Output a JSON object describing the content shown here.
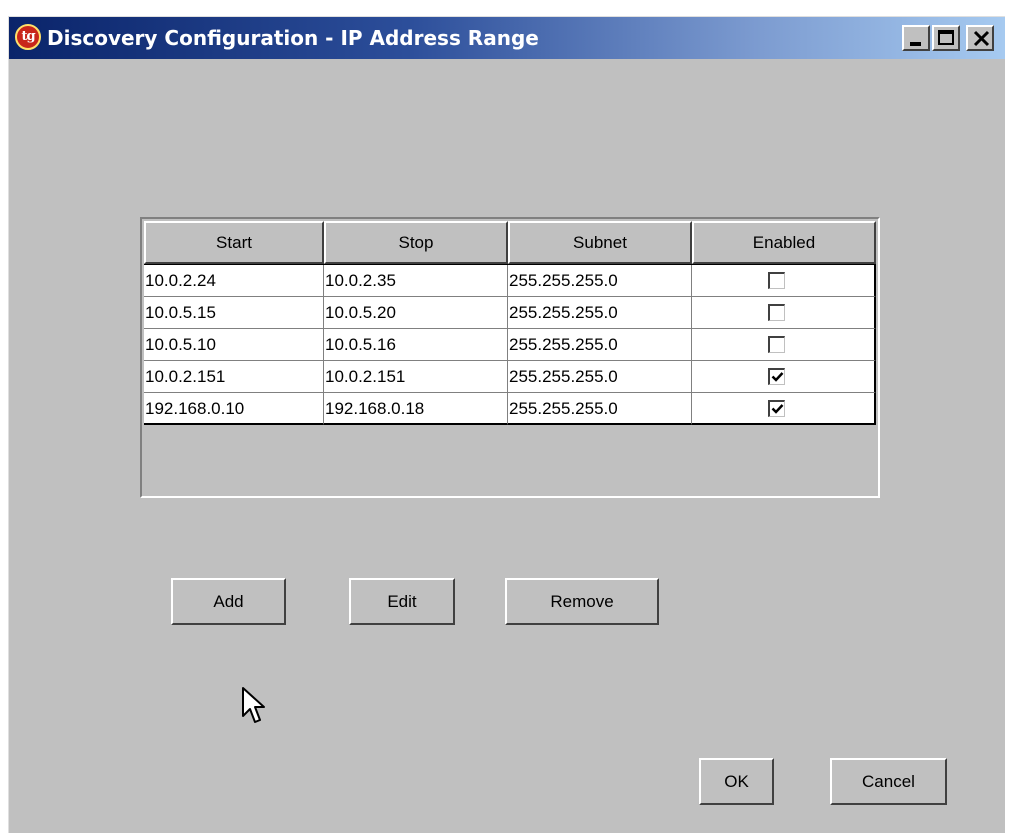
{
  "window": {
    "title": "Discovery Configuration - IP Address Range",
    "app_icon_text": "tg",
    "icon": "app-logo-icon"
  },
  "table": {
    "columns": [
      "Start",
      "Stop",
      "Subnet",
      "Enabled"
    ],
    "rows": [
      {
        "start": "10.0.2.24",
        "stop": "10.0.2.35",
        "subnet": "255.255.255.0",
        "enabled": false
      },
      {
        "start": "10.0.5.15",
        "stop": "10.0.5.20",
        "subnet": "255.255.255.0",
        "enabled": false
      },
      {
        "start": "10.0.5.10",
        "stop": "10.0.5.16",
        "subnet": "255.255.255.0",
        "enabled": false
      },
      {
        "start": "10.0.2.151",
        "stop": "10.0.2.151",
        "subnet": "255.255.255.0",
        "enabled": true
      },
      {
        "start": "192.168.0.10",
        "stop": "192.168.0.18",
        "subnet": "255.255.255.0",
        "enabled": true
      }
    ]
  },
  "buttons": {
    "add": "Add",
    "edit": "Edit",
    "remove": "Remove",
    "ok": "OK",
    "cancel": "Cancel"
  },
  "colors": {
    "window_bg": "#c0c0c0",
    "titlebar_start": "#0a246a",
    "titlebar_end": "#a6caf0",
    "title_text": "#ffffff"
  }
}
